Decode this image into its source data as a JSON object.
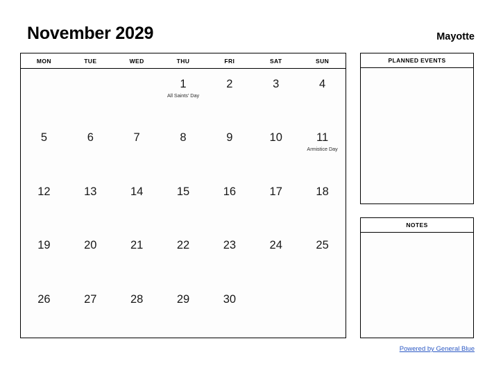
{
  "header": {
    "month_title": "November 2029",
    "region": "Mayotte"
  },
  "calendar": {
    "weekday_headers": [
      "MON",
      "TUE",
      "WED",
      "THU",
      "FRI",
      "SAT",
      "SUN"
    ],
    "weeks": [
      [
        {
          "day": "",
          "event": ""
        },
        {
          "day": "",
          "event": ""
        },
        {
          "day": "",
          "event": ""
        },
        {
          "day": "1",
          "event": "All Saints' Day"
        },
        {
          "day": "2",
          "event": ""
        },
        {
          "day": "3",
          "event": ""
        },
        {
          "day": "4",
          "event": ""
        }
      ],
      [
        {
          "day": "5",
          "event": ""
        },
        {
          "day": "6",
          "event": ""
        },
        {
          "day": "7",
          "event": ""
        },
        {
          "day": "8",
          "event": ""
        },
        {
          "day": "9",
          "event": ""
        },
        {
          "day": "10",
          "event": ""
        },
        {
          "day": "11",
          "event": "Armistice Day"
        }
      ],
      [
        {
          "day": "12",
          "event": ""
        },
        {
          "day": "13",
          "event": ""
        },
        {
          "day": "14",
          "event": ""
        },
        {
          "day": "15",
          "event": ""
        },
        {
          "day": "16",
          "event": ""
        },
        {
          "day": "17",
          "event": ""
        },
        {
          "day": "18",
          "event": ""
        }
      ],
      [
        {
          "day": "19",
          "event": ""
        },
        {
          "day": "20",
          "event": ""
        },
        {
          "day": "21",
          "event": ""
        },
        {
          "day": "22",
          "event": ""
        },
        {
          "day": "23",
          "event": ""
        },
        {
          "day": "24",
          "event": ""
        },
        {
          "day": "25",
          "event": ""
        }
      ],
      [
        {
          "day": "26",
          "event": ""
        },
        {
          "day": "27",
          "event": ""
        },
        {
          "day": "28",
          "event": ""
        },
        {
          "day": "29",
          "event": ""
        },
        {
          "day": "30",
          "event": ""
        },
        {
          "day": "",
          "event": ""
        },
        {
          "day": "",
          "event": ""
        }
      ]
    ]
  },
  "panels": {
    "planned_events": {
      "title": "PLANNED EVENTS",
      "content": ""
    },
    "notes": {
      "title": "NOTES",
      "content": ""
    }
  },
  "footer": {
    "link_text": "Powered by General Blue",
    "link_color": "#2b58c4"
  }
}
